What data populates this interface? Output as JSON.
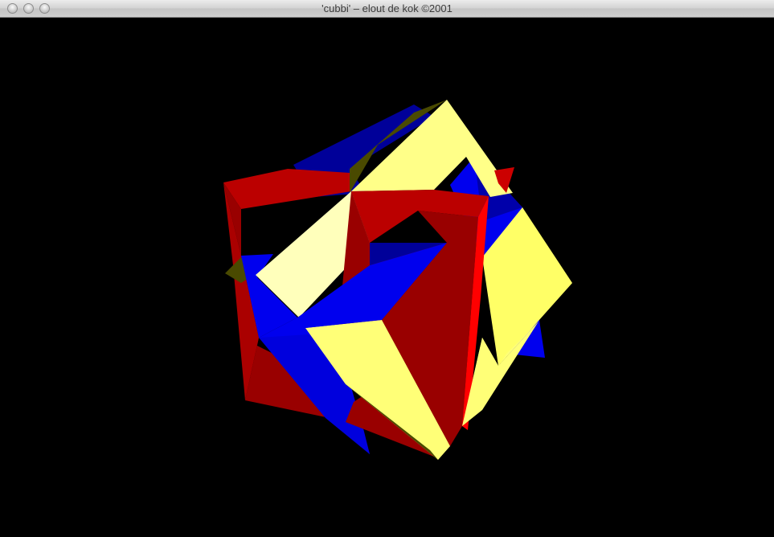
{
  "window": {
    "title": "'cubbi' – elout de kok ©2001",
    "buttons": [
      "close",
      "minimize",
      "zoom"
    ]
  },
  "scene": {
    "background": "#000000",
    "colors": {
      "red_light": "#dd0000",
      "red_dark": "#990000",
      "red_bright": "#ff0000",
      "blue_dark": "#000099",
      "blue": "#0000ee",
      "blue_deep": "#0000aa",
      "yellow_light": "#ffffbb",
      "yellow": "#ffff77",
      "yellow_dark": "#4a4a00"
    }
  }
}
